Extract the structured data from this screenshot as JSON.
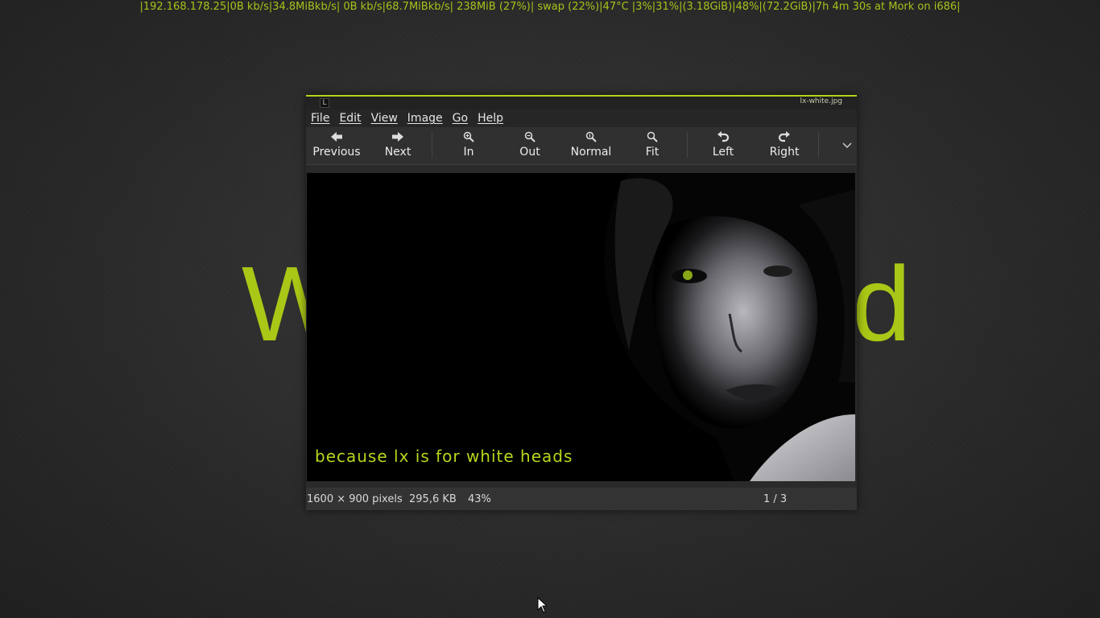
{
  "desktop": {
    "status_line": "|192.168.178.25|0B  kb/s|34.8MiBkb/s| 0B  kb/s|68.7MiBkb/s| 238MiB (27%)| swap (22%)|47°C |3%|31%|(3.18GiB)|48%|(72.2GiB)|7h 4m 30s at Mork on i686|",
    "wallpaper_left": "W",
    "wallpaper_right": "d",
    "accent": "#a9c716"
  },
  "window": {
    "title": "lx-white.jpg"
  },
  "menu": {
    "file": "File",
    "edit": "Edit",
    "view": "View",
    "image": "Image",
    "go": "Go",
    "help": "Help"
  },
  "toolbar": {
    "previous": "Previous",
    "next": "Next",
    "zoom_in": "In",
    "zoom_out": "Out",
    "zoom_normal": "Normal",
    "zoom_fit": "Fit",
    "rotate_left": "Left",
    "rotate_right": "Right"
  },
  "image": {
    "caption": "because lx is for white heads"
  },
  "statusbar": {
    "dimensions": "1600 × 900 pixels",
    "filesize": "295,6 KB",
    "zoom": "43%",
    "position": "1 / 3"
  },
  "icons": {
    "previous": "arrow-left-icon",
    "next": "arrow-right-icon",
    "zoom_in": "zoom-in-icon",
    "zoom_out": "zoom-out-icon",
    "zoom_normal": "zoom-original-icon",
    "zoom_fit": "zoom-fit-icon",
    "rotate_left": "rotate-left-icon",
    "rotate_right": "rotate-right-icon",
    "overflow": "chevron-down-icon"
  }
}
